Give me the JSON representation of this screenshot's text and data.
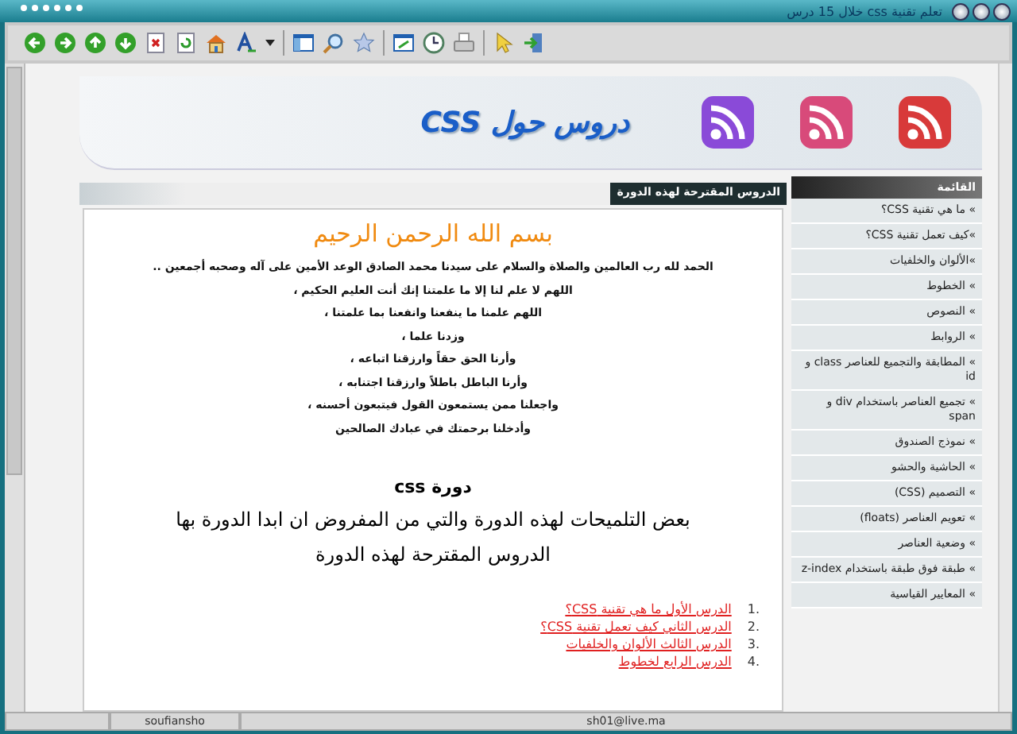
{
  "window": {
    "title": "تعلم تقنية css خلال 15 درس"
  },
  "banner": {
    "title": "دروس حول CSS"
  },
  "sidebar": {
    "title": "القائمة",
    "items": [
      {
        "label": "» ما هي تقنية CSS؟"
      },
      {
        "label": "»كيف تعمل تقنية CSS؟"
      },
      {
        "label": "»الألوان والخلفيات"
      },
      {
        "label": "» الخطوط"
      },
      {
        "label": "» النصوص"
      },
      {
        "label": "» الروابط"
      },
      {
        "label": "» المطابقة والتجميع للعناصر class و id"
      },
      {
        "label": "» تجميع العناصر باستخدام div و span"
      },
      {
        "label": "» نموذج الصندوق"
      },
      {
        "label": "» الحاشية والحشو"
      },
      {
        "label": "» التصميم (CSS)"
      },
      {
        "label": "» تعويم العناصر (floats)"
      },
      {
        "label": "» وضعية العناصر"
      },
      {
        "label": "» طبقة فوق طبقة باستخدام z-index"
      },
      {
        "label": "» المعايير القياسية"
      }
    ]
  },
  "main": {
    "header": "الدروس المقترحة لهذه الدورة",
    "basmala": "بسم الله الرحمن الرحيم",
    "prayer": [
      "الحمد لله رب العالمين والصلاة والسلام على سيدنا محمد الصادق الوعد الأمين على آله وصحبه أجمعين ..",
      "اللهم لا علم لنا إلا ما علمتنا إنك أنت العليم الحكيم ،",
      "اللهم علمنا ما ينفعنا وانفعنا بما علمتنا ،",
      "وزدنا علما ،",
      "وأرنا الحق حقاً وارزقنا اتباعه ،",
      "وأرنا الباطل باطلاً وارزقنا اجتنابه ،",
      "واجعلنا ممن يستمعون القول فيتبعون أحسنه ،",
      "وأدخلنا برحمتك في عبادك الصالحين"
    ],
    "course_title": "دورة css",
    "intro": "بعض التلميحات لهذه الدورة والتي من المفروض ان ابدا الدورة بها",
    "subtitle": "الدروس المقترحة لهذه الدورة",
    "lessons": [
      {
        "number": "1.",
        "title": "الدرس الأول ما هي تقنية CSS؟"
      },
      {
        "number": "2.",
        "title": "الدرس الثاني كيف تعمل تقنية CSS؟"
      },
      {
        "number": "3.",
        "title": "الدرس الثالث الألوان والخلفيات"
      },
      {
        "number": "4.",
        "title": "الدرس الرابع لخطوط"
      }
    ]
  },
  "status_bar": [
    "sh01@live.ma",
    "soufiansho"
  ]
}
